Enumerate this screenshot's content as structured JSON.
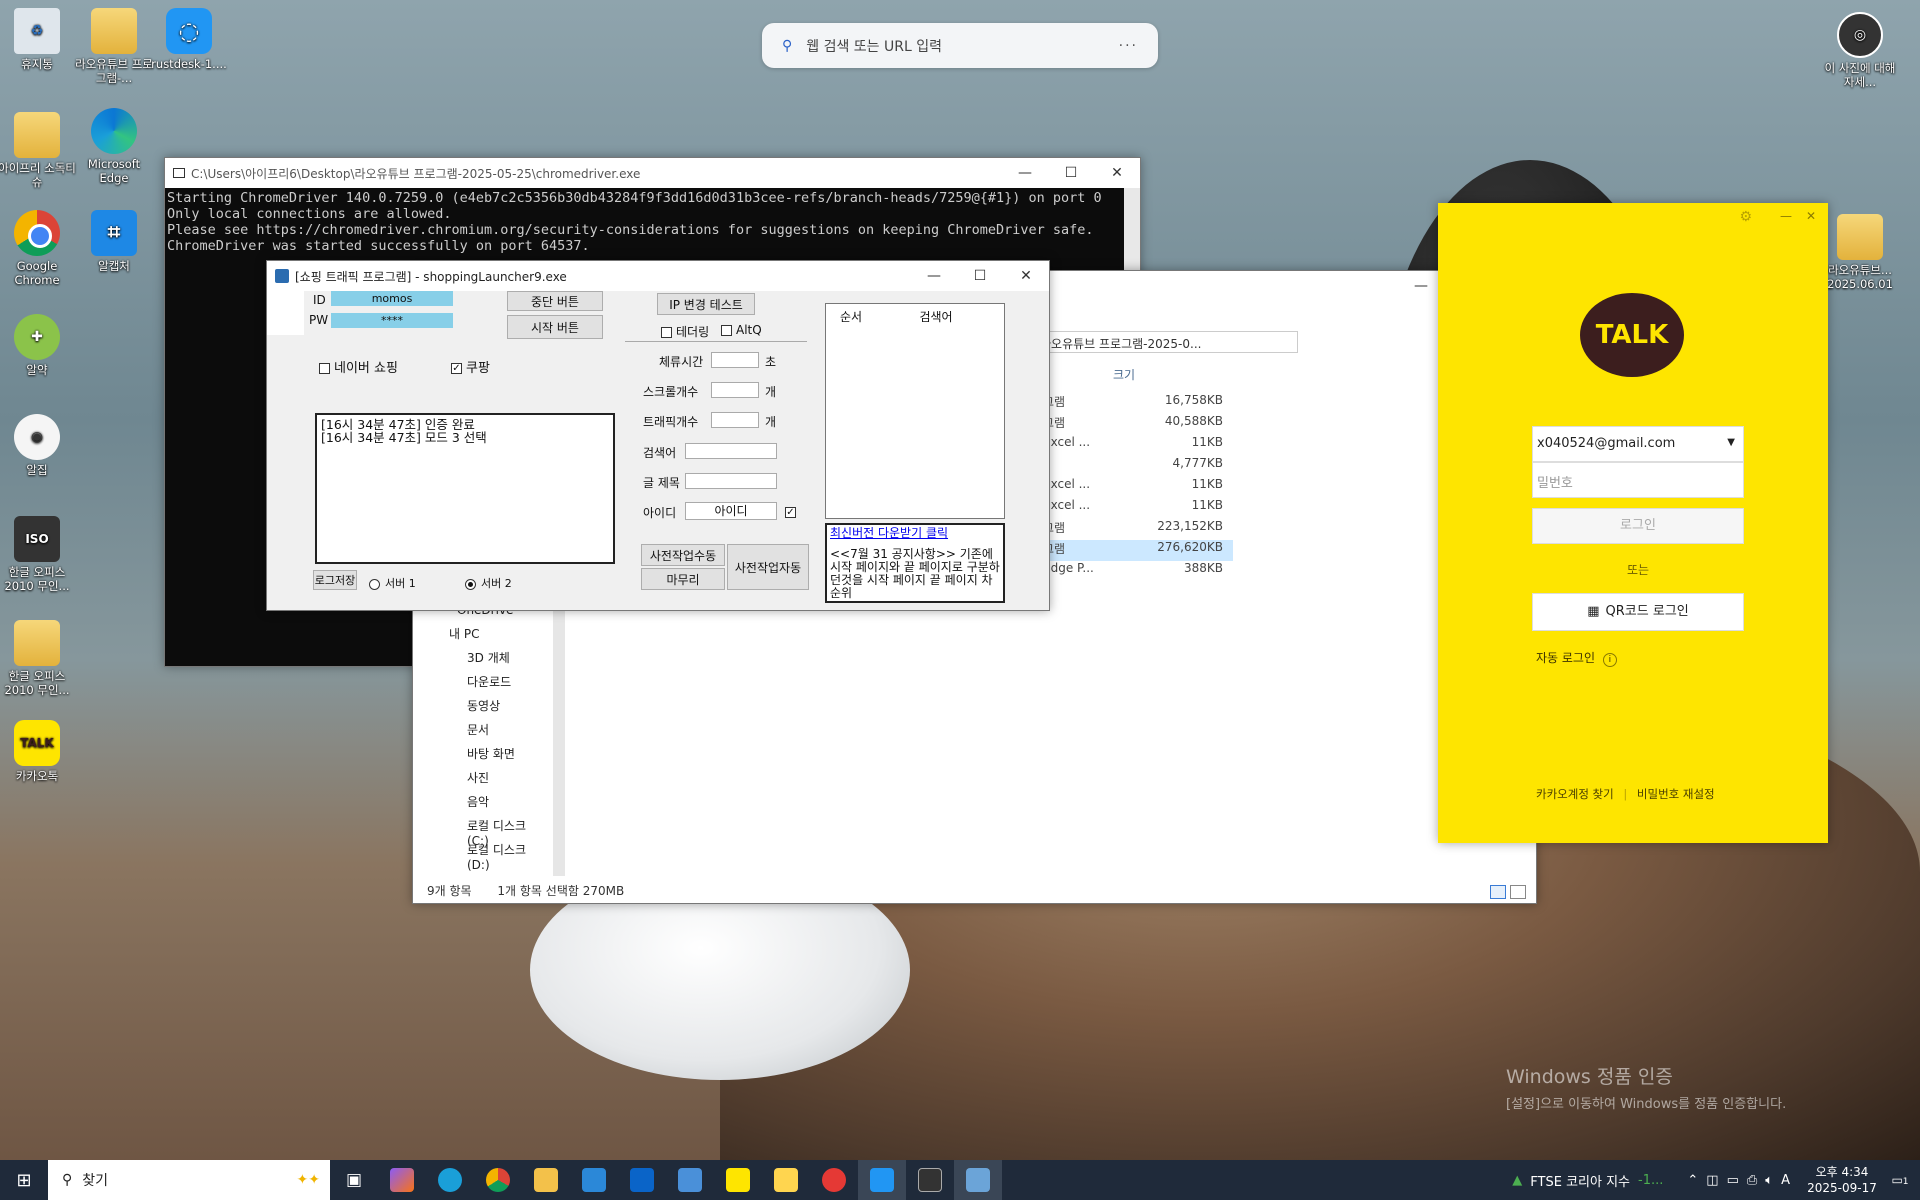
{
  "desktop": {
    "icons": [
      {
        "label": "휴지통"
      },
      {
        "label": "라오유튜브 프로그램-..."
      },
      {
        "label": "rustdesk-1...."
      },
      {
        "label": "아이프리 소독티슈"
      },
      {
        "label": "Microsoft Edge"
      },
      {
        "label": "Google Chrome"
      },
      {
        "label": "알캡처"
      },
      {
        "label": "알약"
      },
      {
        "label": "알집"
      },
      {
        "label": "한글 오피스 2010 무인..."
      },
      {
        "label": "한글 오피스 2010 무인..."
      },
      {
        "label": "카카오톡"
      },
      {
        "label": "이 사진에 대해 자세..."
      },
      {
        "label": "라오유튜브... 2025.06.01"
      }
    ],
    "search_placeholder": "웹 검색 또는 URL 입력",
    "watermark_line1": "Windows 정품 인증",
    "watermark_line2": "[설정]으로 이동하여 Windows를 정품 인증합니다."
  },
  "console": {
    "title": "C:\\Users\\아이프리6\\Desktop\\라오유튜브 프로그램-2025-05-25\\chromedriver.exe",
    "lines": [
      "Starting ChromeDriver 140.0.7259.0 (e4eb7c2c5356b30db43284f9f3dd16d0d31b3cee-refs/branch-heads/7259@{#1}) on port 0",
      "Only local connections are allowed.",
      "Please see https://chromedriver.chromium.org/security-considerations for suggestions on keeping ChromeDriver safe.",
      "ChromeDriver was started successfully on port 64537."
    ]
  },
  "launcher": {
    "title": "[쇼핑 트래픽 프로그램] - shoppingLauncher9.exe",
    "id_label": "ID",
    "id_value": "momos",
    "pw_label": "PW",
    "pw_value": "****",
    "stop_button": "중단 버튼",
    "start_button": "시작 버튼",
    "ip_test_button": "IP 변경 테스트",
    "tethering_label": "테더링",
    "altq_label": "AltQ",
    "naver_label": "네이버 쇼핑",
    "coupang_label": "쿠팡",
    "log_lines": [
      "[16시 34분 47초] 인증 완료",
      "[16시 34분 47초] 모드 3 선택"
    ],
    "stay_label": "체류시간",
    "stay_unit": "초",
    "scroll_label": "스크롤개수",
    "scroll_unit": "개",
    "traffic_label": "트래픽개수",
    "traffic_unit": "개",
    "keyword_label": "검색어",
    "post_title_label": "글 제목",
    "account_label": "아이디",
    "account_value": "아이디",
    "table_col_order": "순서",
    "table_col_keyword": "검색어",
    "log_save": "로그저장",
    "server1": "서버 1",
    "server2": "서버 2",
    "pre_manual": "사전작업수동",
    "finish": "마무리",
    "pre_auto": "사전작업자동",
    "notice_link": "최신버전 다운받기 클릭",
    "notice_text": "<<7월 31 공지사항>> 기존에 시작 페이지와 끝 페이지로 구분하던것을 시작 페이지 끝 페이지 차순위"
  },
  "explorer": {
    "path": "라오유튜브 프로그램-2025-0...",
    "col_size": "크기",
    "rows": [
      {
        "type": "그램",
        "size": "16,758KB"
      },
      {
        "type": "그램",
        "size": "40,588KB"
      },
      {
        "type": "Excel ...",
        "size": "11KB"
      },
      {
        "type": "",
        "size": "4,777KB"
      },
      {
        "type": "Excel ...",
        "size": "11KB"
      },
      {
        "type": "Excel ...",
        "size": "11KB"
      },
      {
        "type": "그램",
        "size": "223,152KB"
      },
      {
        "type": "그램",
        "size": "276,620KB"
      },
      {
        "type": "Edge P...",
        "size": "388KB"
      }
    ],
    "nav": [
      "OneDrive",
      "내 PC",
      "3D 개체",
      "다운로드",
      "동영상",
      "문서",
      "바탕 화면",
      "사진",
      "음악",
      "로컬 디스크 (C:)",
      "로컬 디스크 (D:)"
    ],
    "status_count": "9개 항목",
    "status_selected": "1개 항목 선택함 270MB"
  },
  "kakao": {
    "logo": "TALK",
    "email": "x040524@gmail.com",
    "password_placeholder": "밀번호",
    "login_button": "로그인",
    "or_text": "또는",
    "qr_button": "QR코드 로그인",
    "auto_login": "자동 로그인",
    "find_account": "카카오계정 찾기",
    "reset_password": "비밀번호 재설정"
  },
  "taskbar": {
    "search_label": "찾기",
    "ticker": "FTSE 코리아 지수",
    "ticker_change": "-1...",
    "ime": "A",
    "time": "오후 4:34",
    "date": "2025-09-17",
    "notif_count": "1"
  }
}
